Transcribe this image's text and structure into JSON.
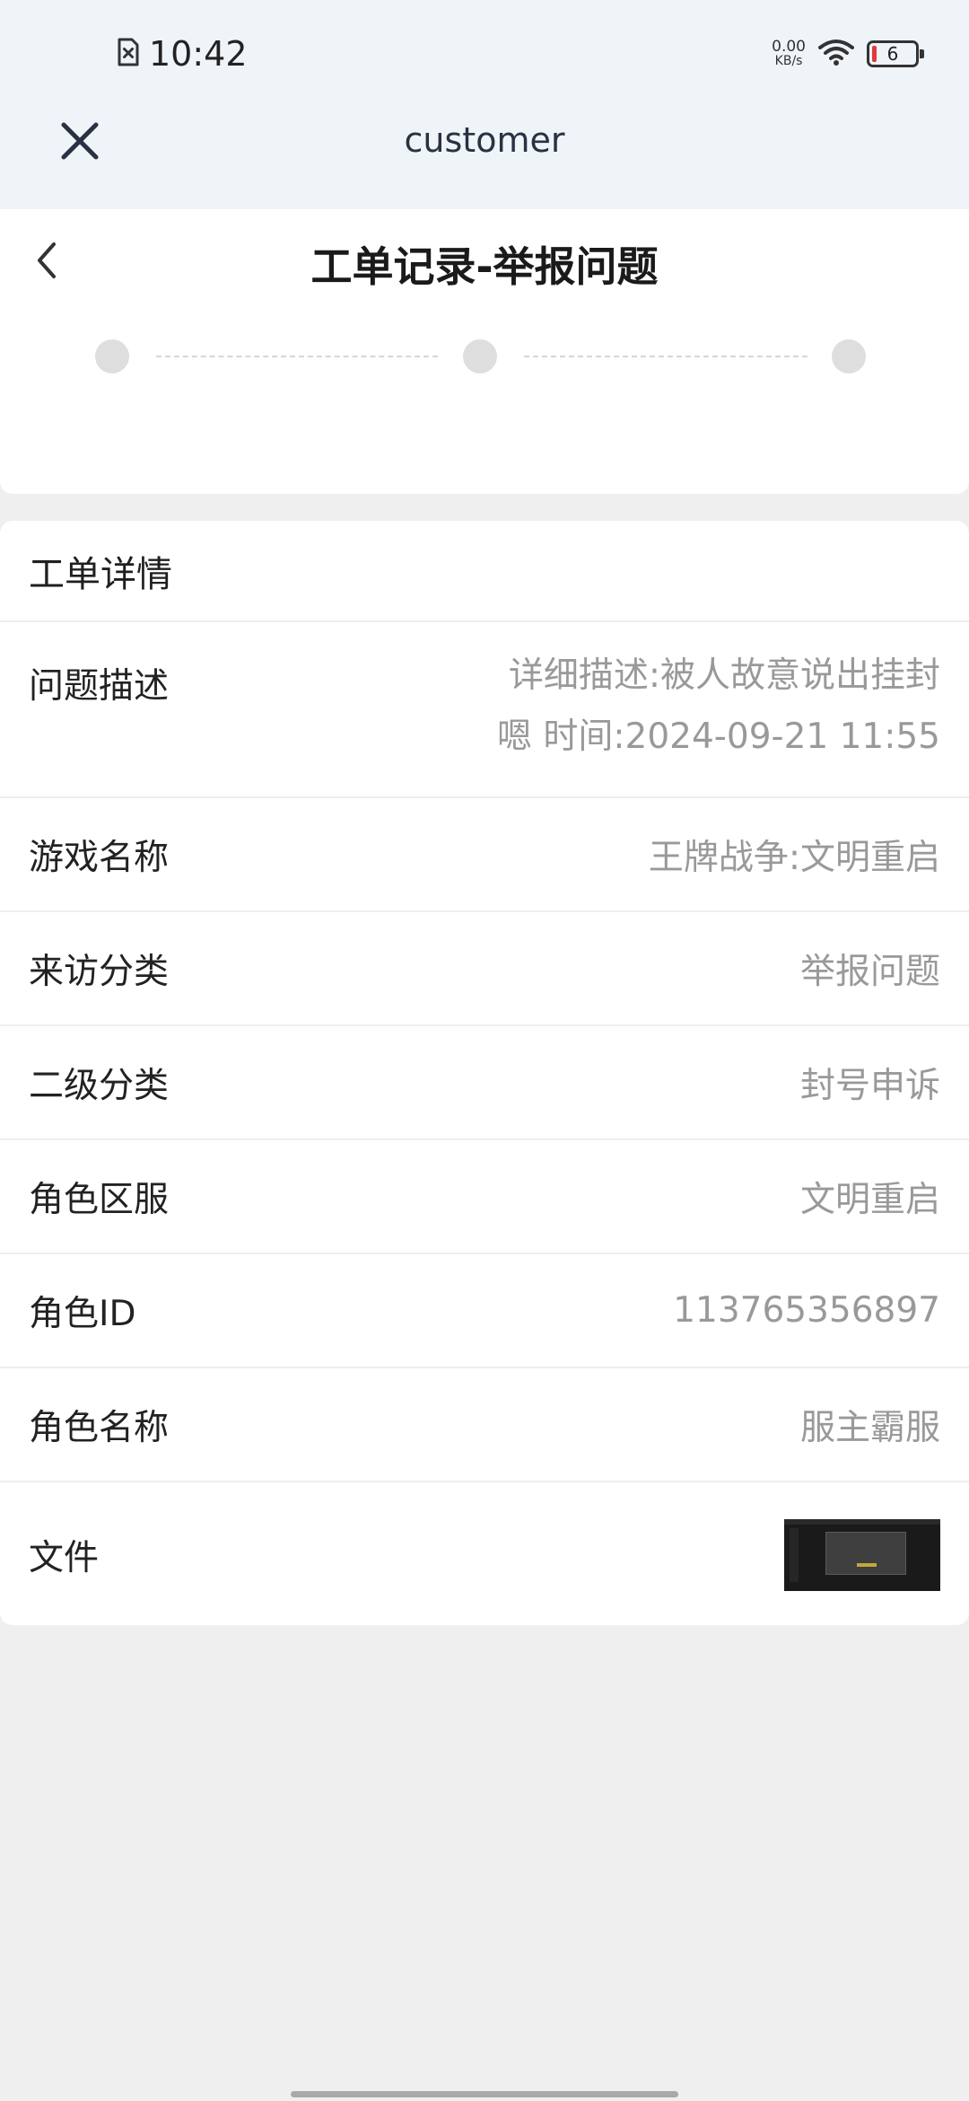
{
  "status_bar": {
    "time": "10:42",
    "net_speed_value": "0.00",
    "net_speed_unit": "KB/s",
    "battery_level": "6"
  },
  "app_header": {
    "title": "customer"
  },
  "page_header": {
    "title": "工单记录-举报问题"
  },
  "progress": {
    "steps": 3
  },
  "detail": {
    "card_title": "工单详情",
    "rows": [
      {
        "label": "问题描述",
        "value": "详细描述:被人故意说出挂封嗯 时间:2024-09-21 11:55"
      },
      {
        "label": "游戏名称",
        "value": "王牌战争:文明重启"
      },
      {
        "label": "来访分类",
        "value": "举报问题"
      },
      {
        "label": "二级分类",
        "value": "封号申诉"
      },
      {
        "label": "角色区服",
        "value": "文明重启"
      },
      {
        "label": "角色ID",
        "value": "113765356897"
      },
      {
        "label": "角色名称",
        "value": "服主霸服"
      },
      {
        "label": "文件",
        "value": ""
      }
    ]
  },
  "colors": {
    "header_bg": "#eff4f8",
    "page_bg": "#efefef",
    "value_text": "#999999",
    "step_dot": "#dedede"
  }
}
